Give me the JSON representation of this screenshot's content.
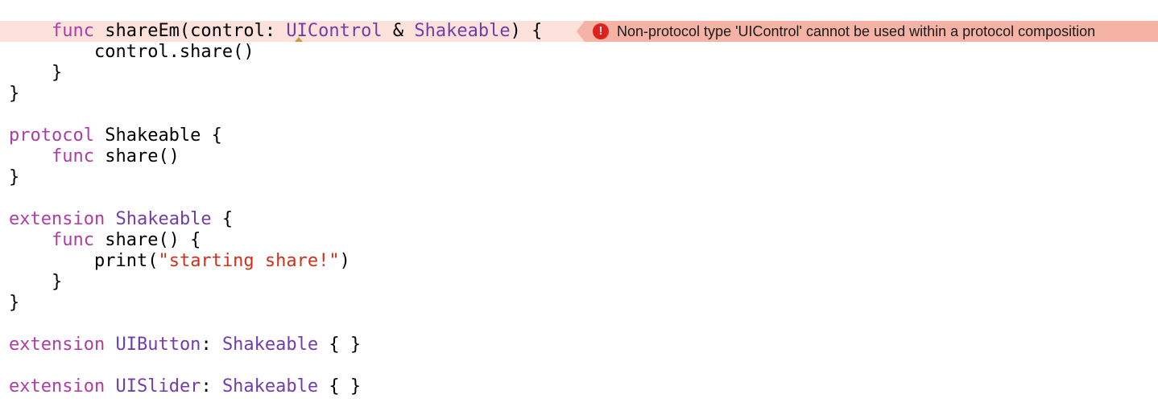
{
  "editor": {
    "lines": [
      {
        "indent": "    ",
        "tokens": [
          {
            "t": "kw",
            "v": "func"
          },
          {
            "t": "pl",
            "v": " shareEm(control: "
          },
          {
            "t": "ty",
            "v": "UIControl"
          },
          {
            "t": "pl",
            "v": " & "
          },
          {
            "t": "ty",
            "v": "Shakeable"
          },
          {
            "t": "pl",
            "v": ") {"
          }
        ]
      },
      {
        "indent": "        ",
        "tokens": [
          {
            "t": "pl",
            "v": "control.share()"
          }
        ]
      },
      {
        "indent": "    ",
        "tokens": [
          {
            "t": "pl",
            "v": "}"
          }
        ]
      },
      {
        "indent": "",
        "tokens": [
          {
            "t": "pl",
            "v": "}"
          }
        ]
      },
      {
        "indent": "",
        "tokens": []
      },
      {
        "indent": "",
        "tokens": [
          {
            "t": "kw",
            "v": "protocol"
          },
          {
            "t": "pl",
            "v": " Shakeable {"
          }
        ]
      },
      {
        "indent": "    ",
        "tokens": [
          {
            "t": "kw",
            "v": "func"
          },
          {
            "t": "pl",
            "v": " share()"
          }
        ]
      },
      {
        "indent": "",
        "tokens": [
          {
            "t": "pl",
            "v": "}"
          }
        ]
      },
      {
        "indent": "",
        "tokens": []
      },
      {
        "indent": "",
        "tokens": [
          {
            "t": "kw",
            "v": "extension"
          },
          {
            "t": "pl",
            "v": " "
          },
          {
            "t": "ty",
            "v": "Shakeable"
          },
          {
            "t": "pl",
            "v": " {"
          }
        ]
      },
      {
        "indent": "    ",
        "tokens": [
          {
            "t": "kw",
            "v": "func"
          },
          {
            "t": "pl",
            "v": " share() {"
          }
        ]
      },
      {
        "indent": "        ",
        "tokens": [
          {
            "t": "pl",
            "v": "print("
          },
          {
            "t": "str",
            "v": "\"starting share!\""
          },
          {
            "t": "pl",
            "v": ")"
          }
        ]
      },
      {
        "indent": "    ",
        "tokens": [
          {
            "t": "pl",
            "v": "}"
          }
        ]
      },
      {
        "indent": "",
        "tokens": [
          {
            "t": "pl",
            "v": "}"
          }
        ]
      },
      {
        "indent": "",
        "tokens": []
      },
      {
        "indent": "",
        "tokens": [
          {
            "t": "kw",
            "v": "extension"
          },
          {
            "t": "pl",
            "v": " "
          },
          {
            "t": "ty",
            "v": "UIButton"
          },
          {
            "t": "pl",
            "v": ": "
          },
          {
            "t": "ty",
            "v": "Shakeable"
          },
          {
            "t": "pl",
            "v": " { }"
          }
        ]
      },
      {
        "indent": "",
        "tokens": []
      },
      {
        "indent": "",
        "tokens": [
          {
            "t": "kw",
            "v": "extension"
          },
          {
            "t": "pl",
            "v": " "
          },
          {
            "t": "ty",
            "v": "UISlider"
          },
          {
            "t": "pl",
            "v": ": "
          },
          {
            "t": "ty",
            "v": "Shakeable"
          },
          {
            "t": "pl",
            "v": " { }"
          }
        ]
      }
    ]
  },
  "error": {
    "icon": "error-icon",
    "icon_glyph": "!",
    "message": "Non-protocol type 'UIControl' cannot be used within a protocol composition"
  },
  "colors": {
    "keyword": "#ad3da4",
    "type": "#703daa",
    "string": "#d12f1b",
    "error_line_bg": "#fde1db",
    "error_banner_bg": "#f5b3a5",
    "error_icon_bg": "#e0201c"
  }
}
